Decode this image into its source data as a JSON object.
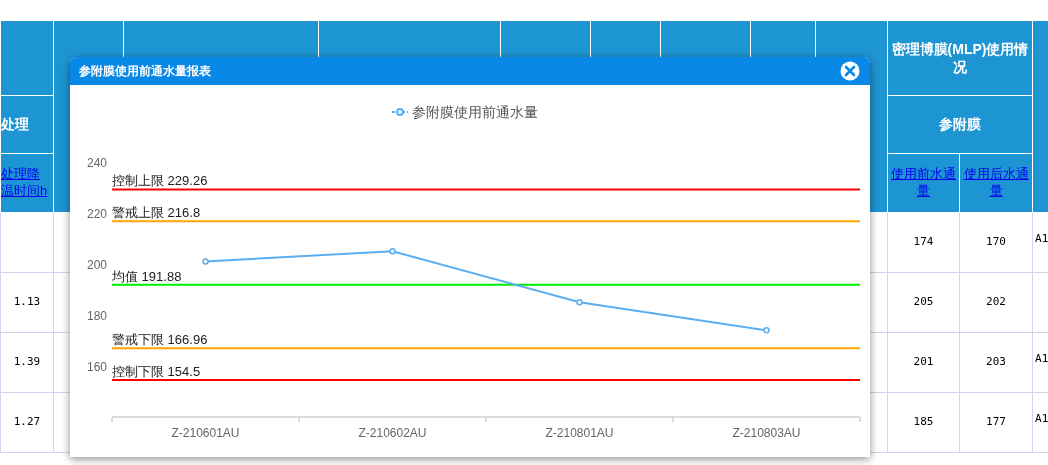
{
  "table": {
    "header": {
      "first_row2": "处理",
      "first_row3": "处理降温时间h",
      "group": "密理博膜(MLP)使用情况",
      "subgroup": "参附膜",
      "columns": [
        "使用前水通量",
        "使用后水通量"
      ]
    },
    "rows": [
      {
        "before": "174",
        "after": "170",
        "column_last": "A1"
      },
      {
        "column_1": "1.13",
        "before": "205",
        "after": "202"
      },
      {
        "column_1": "1.39",
        "before": "201",
        "after": "203",
        "column_last": "A1"
      },
      {
        "column_1": "1.27",
        "before": "185",
        "after": "177",
        "column_last": "A1"
      }
    ]
  },
  "dialog": {
    "title": "参附膜使用前通水量报表",
    "chart_data": {
      "type": "line",
      "categories": [
        "Z-210601AU",
        "Z-210602AU",
        "Z-210801AU",
        "Z-210803AU"
      ],
      "series": [
        {
          "name": "参附膜使用前通水量",
          "color": "#5aaef0",
          "marker": "circle",
          "values": [
            201,
            205,
            185,
            174
          ]
        }
      ],
      "ylim": [
        140,
        240
      ],
      "yticks": [
        160,
        180,
        200,
        220,
        240
      ],
      "ref_lines": [
        {
          "axis": "y",
          "value": 229.26,
          "label": "控制上限 229.26",
          "color": "#ff0000"
        },
        {
          "axis": "y",
          "value": 216.8,
          "label": "警戒上限 216.8",
          "color": "#ffa500"
        },
        {
          "axis": "y",
          "value": 191.88,
          "label": "均值 191.88",
          "color": "#00ee00"
        },
        {
          "axis": "y",
          "value": 166.96,
          "label": "警戒下限 166.96",
          "color": "#ffa500"
        },
        {
          "axis": "y",
          "value": 154.5,
          "label": "控制下限 154.5",
          "color": "#ff0000"
        }
      ]
    }
  }
}
